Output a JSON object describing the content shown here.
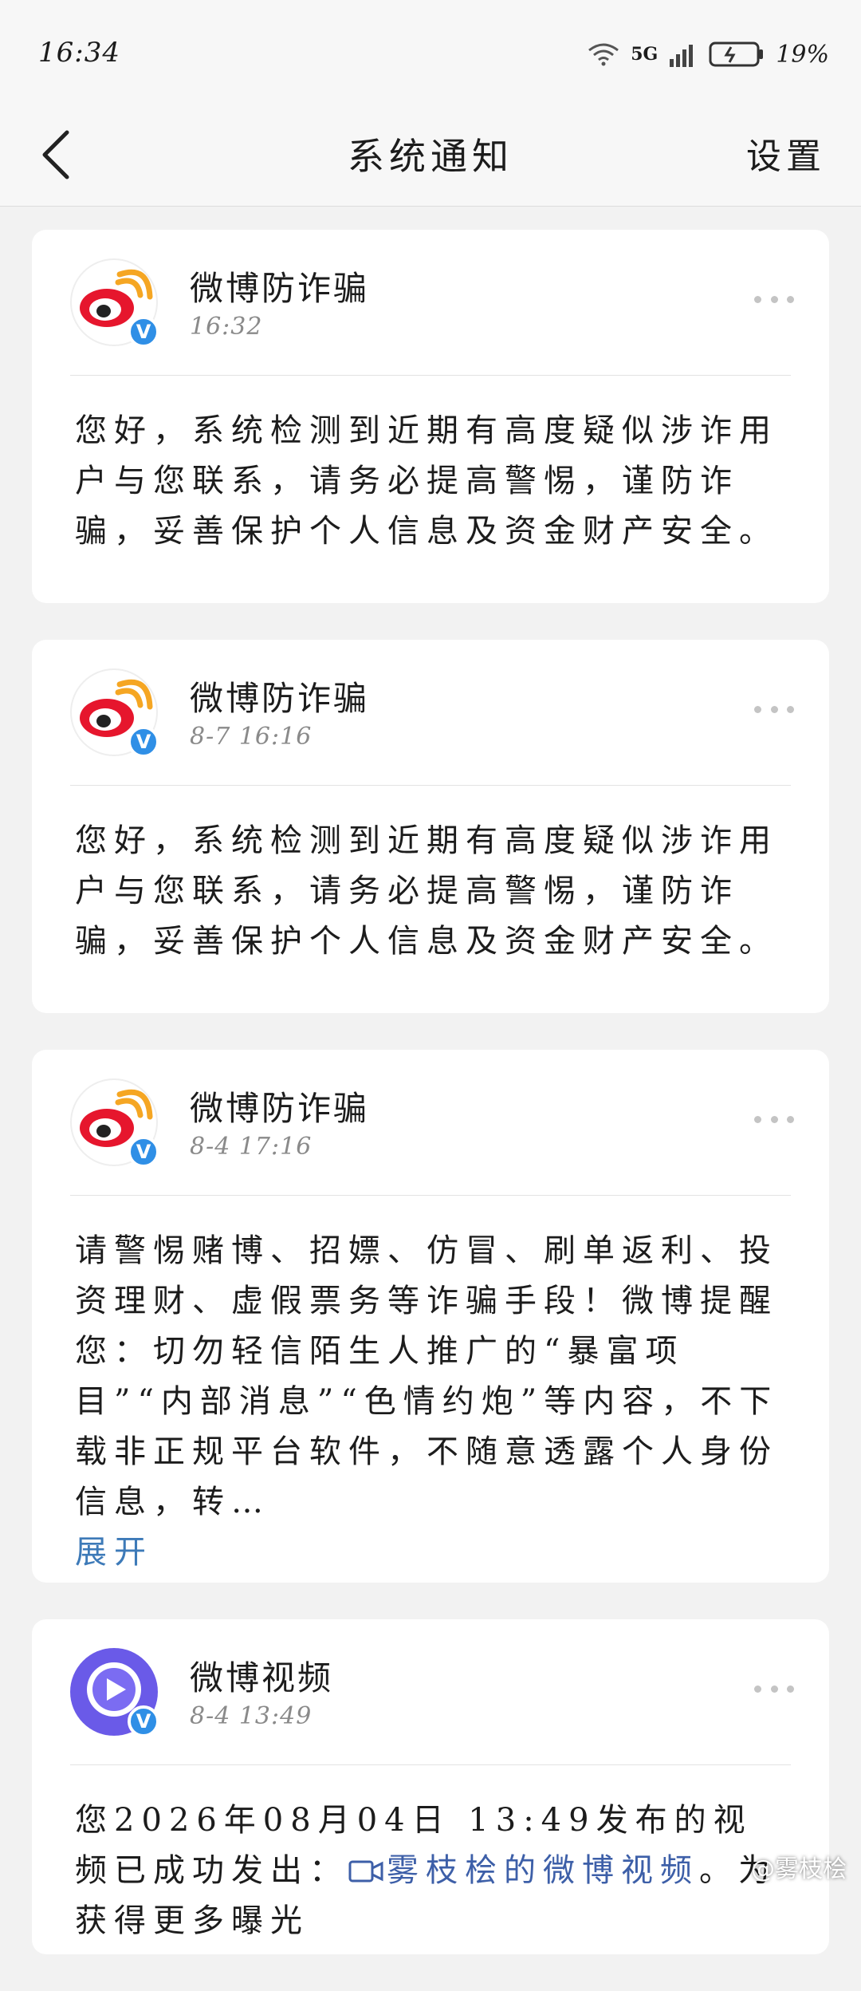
{
  "status_bar": {
    "time": "16:34",
    "network": "5G",
    "battery": "19%"
  },
  "nav": {
    "title": "系统通知",
    "settings_label": "设置"
  },
  "notifications": [
    {
      "sender": "微博防诈骗",
      "time": "16:32",
      "body": "您好，系统检测到近期有高度疑似涉诈用户与您联系，请务必提高警惕，谨防诈骗，妥善保护个人信息及资金财产安全。"
    },
    {
      "sender": "微博防诈骗",
      "time": "8-7 16:16",
      "body": "您好，系统检测到近期有高度疑似涉诈用户与您联系，请务必提高警惕，谨防诈骗，妥善保护个人信息及资金财产安全。"
    },
    {
      "sender": "微博防诈骗",
      "time": "8-4 17:16",
      "body": "请警惕赌博、招嫖、仿冒、刷单返利、投资理财、虚假票务等诈骗手段！微博提醒您：切勿轻信陌生人推广的“暴富项目”“内部消息”“色情约炮”等内容，不下载非正规平台软件，不随意透露个人身份信息，转…",
      "expand_label": "展开"
    },
    {
      "sender": "微博视频",
      "time": "8-4 13:49",
      "body_prefix": "您2026年08月04日 13:49发布的视频已成功发出：",
      "link_text": "雾枝桧的微博视频",
      "body_suffix": "。为获得更多曝光"
    }
  ],
  "watermark": "@雾枝桧",
  "colors": {
    "weibo_red": "#e6162d",
    "weibo_orange": "#f5a623",
    "verify_blue": "#2f8fe6",
    "link_blue": "#3d5fa8"
  }
}
